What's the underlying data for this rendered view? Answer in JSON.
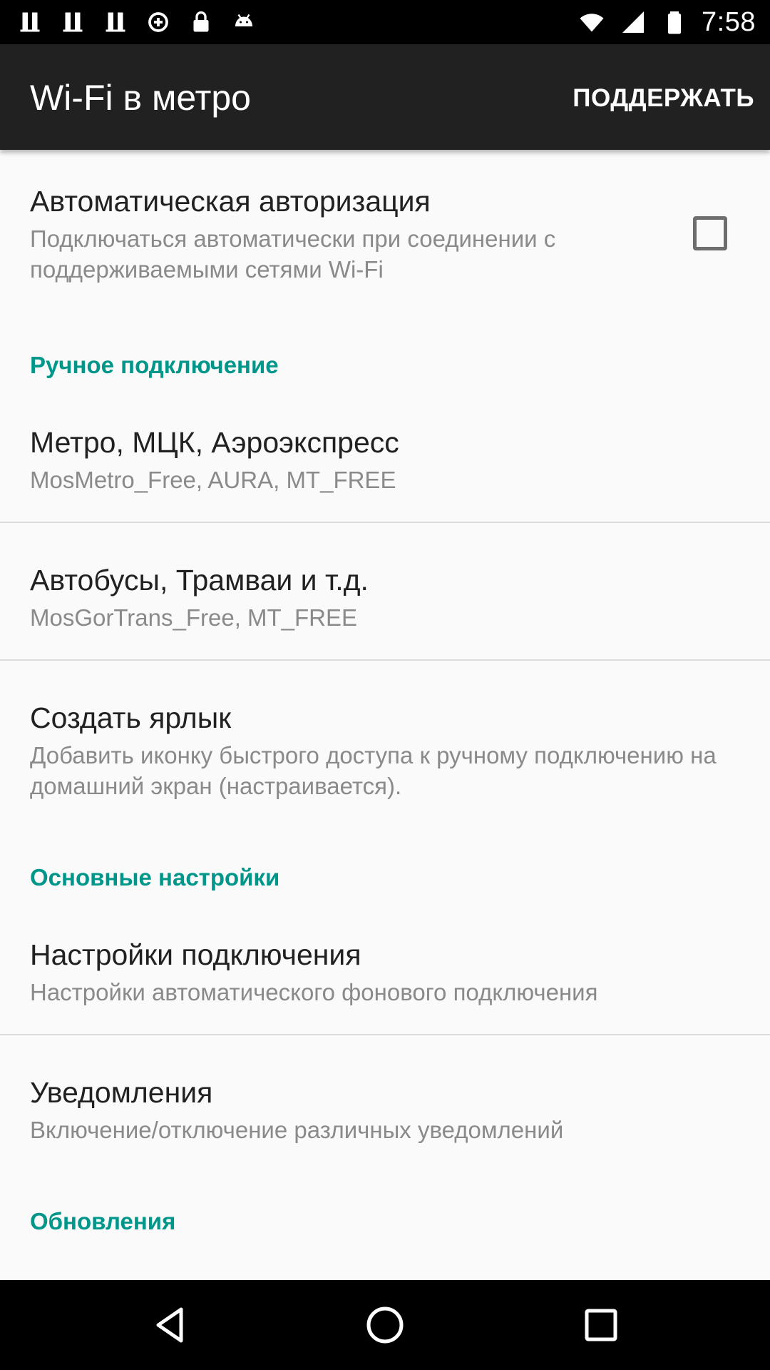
{
  "status_bar": {
    "time": "7:58",
    "left_icons": [
      "notification-app-icon",
      "notification-app-icon",
      "notification-app-icon",
      "data-saver-icon",
      "lock-icon",
      "android-icon"
    ],
    "right_icons": [
      "wifi-icon",
      "signal-icon",
      "battery-icon"
    ]
  },
  "app_bar": {
    "title": "Wi-Fi в метро",
    "action_label": "ПОДДЕРЖАТЬ"
  },
  "preferences": {
    "auto_auth": {
      "title": "Автоматическая авторизация",
      "summary": "Подключаться автоматически при соединении с поддерживаемыми сетями Wi-Fi",
      "checked": false
    },
    "manual_category": "Ручное подключение",
    "metro": {
      "title": "Метро, МЦК, Аэроэкспресс",
      "summary": "MosMetro_Free, AURA, MT_FREE"
    },
    "buses": {
      "title": "Автобусы, Трамваи и т.д.",
      "summary": "MosGorTrans_Free, MT_FREE"
    },
    "shortcut": {
      "title": "Создать ярлык",
      "summary": "Добавить иконку быстрого доступа к ручному подключению на домашний экран (настраивается)."
    },
    "main_category": "Основные настройки",
    "connection_settings": {
      "title": "Настройки подключения",
      "summary": "Настройки автоматического фонового подключения"
    },
    "notifications": {
      "title": "Уведомления",
      "summary": "Включение/отключение различных уведомлений"
    },
    "updates_category": "Обновления"
  },
  "nav_bar": {
    "buttons": [
      "back-icon",
      "home-icon",
      "recents-icon"
    ]
  },
  "colors": {
    "accent": "#00968a",
    "app_bar": "#212121",
    "background": "#fafafa",
    "title_text": "#212121",
    "summary_text": "#8a8a8a"
  }
}
